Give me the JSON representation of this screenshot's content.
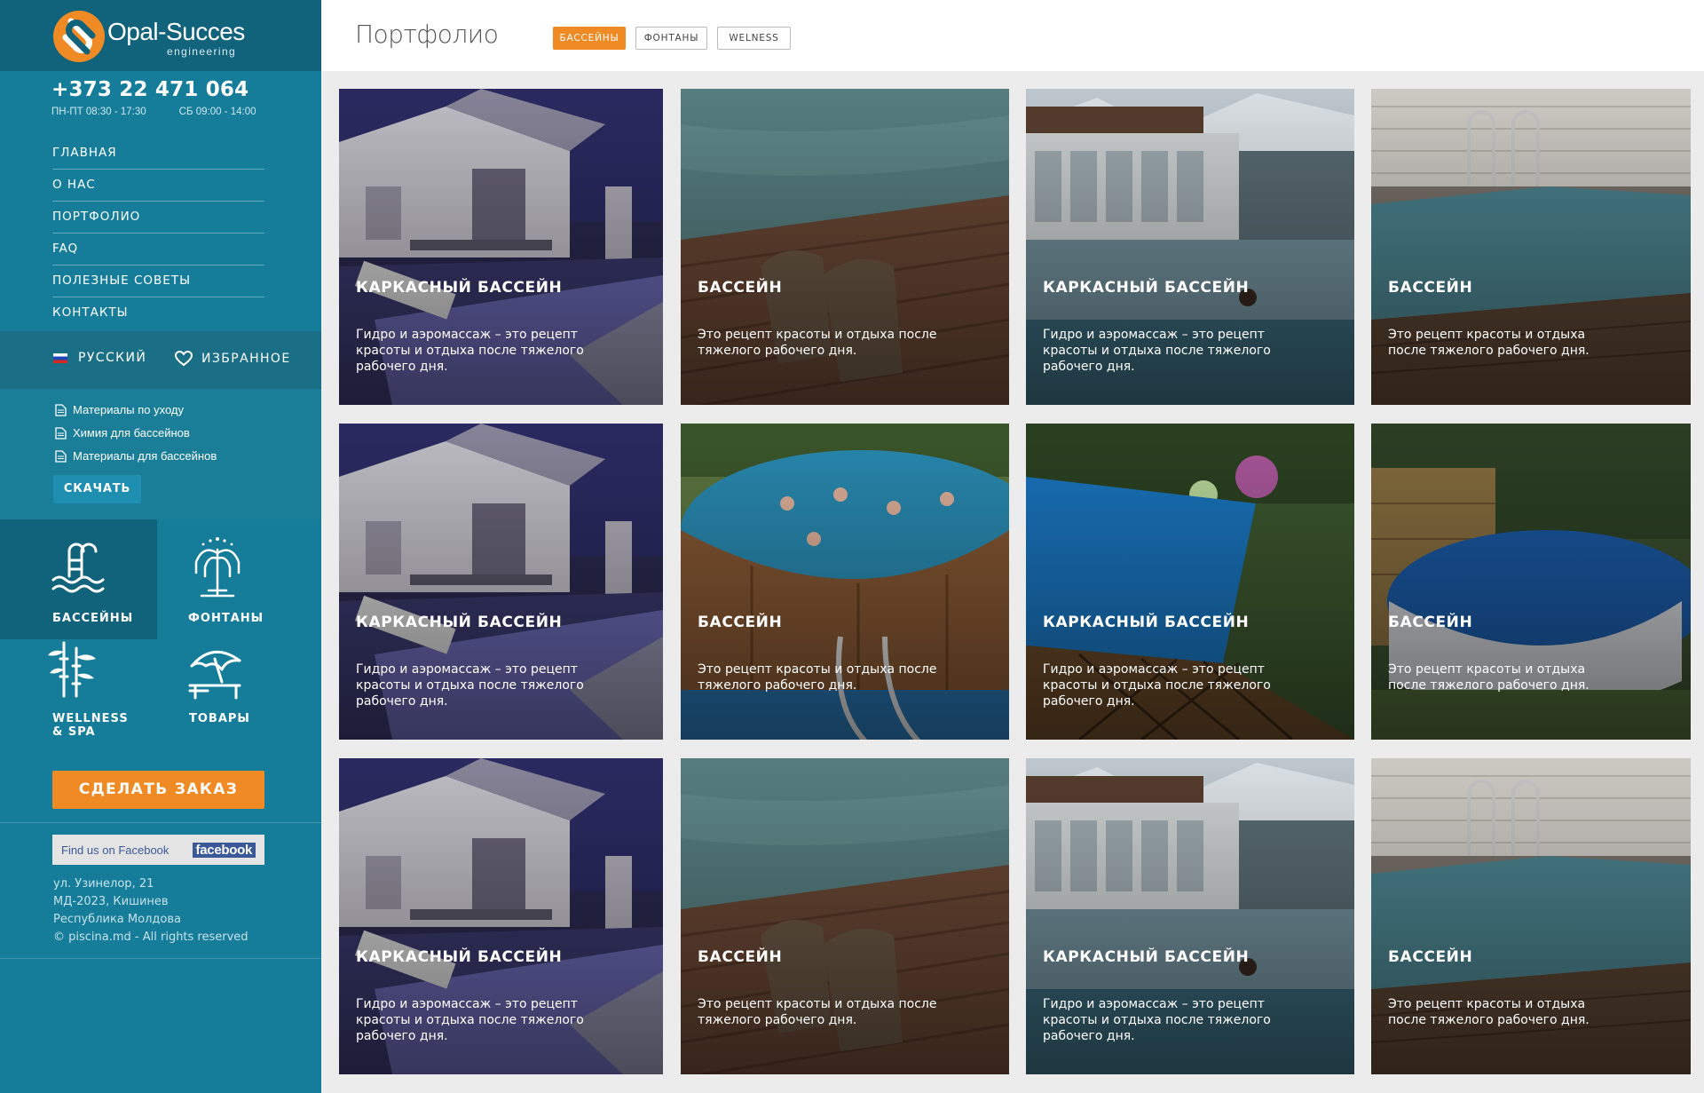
{
  "brand": {
    "name": "Opal-Succes",
    "sub": "engineering"
  },
  "contact": {
    "phone": "+373 22 471 064",
    "hours_weekday": "ПН-ПТ  08:30 - 17:30",
    "hours_saturday": "СБ 09:00 - 14:00"
  },
  "nav": [
    "ГЛАВНАЯ",
    "О НАС",
    "ПОРТФОЛИО",
    "FAQ",
    "ПОЛЕЗНЫЕ СОВЕТЫ",
    "КОНТАКТЫ"
  ],
  "language": "РУССКИЙ",
  "favorites": "ИЗБРАННОЕ",
  "documents": [
    "Материалы по уходу",
    "Химия для бассейнов",
    "Материалы для бассейнов"
  ],
  "download_label": "СКАЧАТЬ",
  "categories": [
    {
      "label": "БАССЕЙНЫ",
      "icon": "pool-ladder-icon",
      "active": true
    },
    {
      "label": "ФОНТАНЫ",
      "icon": "fountain-icon",
      "active": false
    },
    {
      "label_line1": "WELLNESS",
      "label_line2": "& SPA",
      "icon": "bamboo-icon",
      "active": false
    },
    {
      "label": "ТОВАРЫ",
      "icon": "beach-umbrella-icon",
      "active": false
    }
  ],
  "order_label": "СДЕЛАТЬ ЗАКАЗ",
  "facebook": {
    "find": "Find us on Facebook",
    "logo": "facebook"
  },
  "address": [
    "ул. Узинелор, 21",
    "МД-2023, Кишинев",
    "Республика Молдова",
    "© piscina.md - All rights reserved"
  ],
  "page_title": "Портфолио",
  "filters": [
    {
      "label": "БАССЕЙНЫ",
      "active": true
    },
    {
      "label": "ФОНТАНЫ",
      "active": false
    },
    {
      "label": "WELNESS",
      "active": false
    }
  ],
  "colors": {
    "brand_teal": "#157d99",
    "dark_teal": "#11637c",
    "accent_orange": "#f08a24"
  },
  "portfolio": [
    {
      "title": "КАРКАСНЫЙ БАССЕЙН",
      "description": "Гидро и аэромассаж – это рецепт красоты и отдыха после тяжелого рабочего дня.",
      "scene": "night-villa-pool"
    },
    {
      "title": "БАССЕЙН",
      "description": "Это рецепт красоты и отдыха после тяжелого  рабочего дня.",
      "scene": "deck-chairs-pool"
    },
    {
      "title": "КАРКАСНЫЙ БАССЕЙН",
      "description": "Гидро и аэромассаж – это рецепт красоты и отдыха после тяжелого рабочего дня.",
      "scene": "snow-spa-pool"
    },
    {
      "title": "БАССЕЙН",
      "description": "Это рецепт красоты и отдыха после тяжелого  рабочего дня.",
      "scene": "wooden-above-ground-pool"
    },
    {
      "title": "КАРКАСНЫЙ БАССЕЙН",
      "description": "Гидро и аэромассаж – это рецепт красоты и отдыха после тяжелого рабочего дня.",
      "scene": "night-villa-pool"
    },
    {
      "title": "БАССЕЙН",
      "description": "Это рецепт красоты и отдыха после тяжелого  рабочего дня.",
      "scene": "round-frame-pool-people"
    },
    {
      "title": "КАРКАСНЫЙ БАССЕЙН",
      "description": "Гидро и аэромассаж – это рецепт красоты и отдыха после тяжелого рабочего дня.",
      "scene": "garden-pool-lattice"
    },
    {
      "title": "БАССЕЙН",
      "description": "Это рецепт красоты и отдыха после тяжелого  рабочего дня.",
      "scene": "round-pool-fence"
    },
    {
      "title": "КАРКАСНЫЙ БАССЕЙН",
      "description": "Гидро и аэромассаж – это рецепт красоты и отдыха после тяжелого рабочего дня.",
      "scene": "night-villa-pool"
    },
    {
      "title": "БАССЕЙН",
      "description": "Это рецепт красоты и отдыха после тяжелого  рабочего дня.",
      "scene": "deck-chairs-pool"
    },
    {
      "title": "КАРКАСНЫЙ БАССЕЙН",
      "description": "Гидро и аэромассаж – это рецепт красоты и отдыха после тяжелого рабочего дня.",
      "scene": "snow-spa-pool"
    },
    {
      "title": "БАССЕЙН",
      "description": "Это рецепт красоты и отдыха после тяжелого  рабочего дня.",
      "scene": "wooden-above-ground-pool"
    }
  ]
}
